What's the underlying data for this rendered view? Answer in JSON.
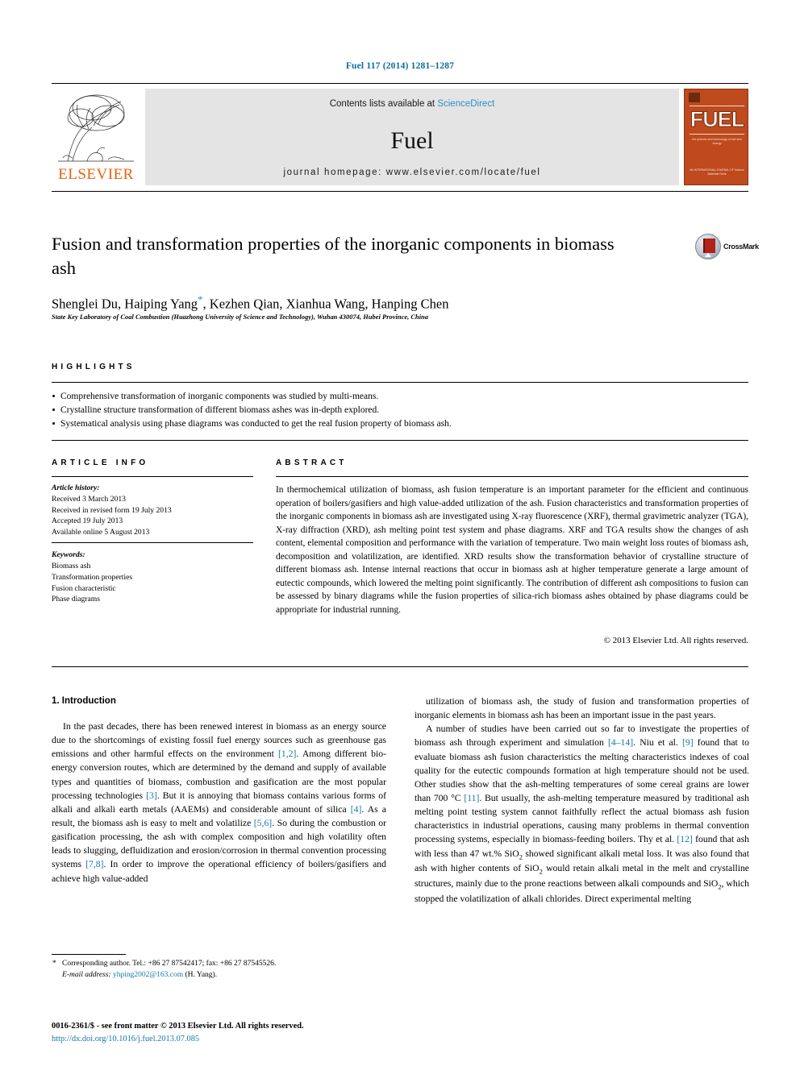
{
  "journal_ref": "Fuel 117 (2014) 1281–1287",
  "header": {
    "publisher": "ELSEVIER",
    "contents_prefix": "Contents lists available at ",
    "contents_link": "ScienceDirect",
    "journal_title": "Fuel",
    "homepage": "journal homepage: www.elsevier.com/locate/fuel",
    "cover": {
      "word": "FUEL",
      "subtitle": "the science and technology of fuel and energy",
      "footer": "AN INTERNATIONAL JOURNAL OF\nScience Materials Fuels"
    }
  },
  "article": {
    "title": "Fusion and transformation properties of the inorganic components in biomass ash",
    "authors": "Shenglei Du, Haiping Yang",
    "authors_tail": ", Kezhen Qian, Xianhua Wang, Hanping Chen",
    "corresponding_marker": "*",
    "affiliation": "State Key Laboratory of Coal Combustion (Huazhong University of Science and Technology), Wuhan 430074, Hubei Province, China",
    "crossmark_label": "CrossMark"
  },
  "highlights": {
    "heading": "HIGHLIGHTS",
    "items": [
      "Comprehensive transformation of inorganic components was studied by multi-means.",
      "Crystalline structure transformation of different biomass ashes was in-depth explored.",
      "Systematical analysis using phase diagrams was conducted to get the real fusion property of biomass ash."
    ]
  },
  "article_info": {
    "heading": "ARTICLE INFO",
    "history_label": "Article history:",
    "history": [
      "Received 3 March 2013",
      "Received in revised form 19 July 2013",
      "Accepted 19 July 2013",
      "Available online 5 August 2013"
    ],
    "keywords_label": "Keywords:",
    "keywords": [
      "Biomass ash",
      "Transformation properties",
      "Fusion characteristic",
      "Phase diagrams"
    ]
  },
  "abstract": {
    "heading": "ABSTRACT",
    "text": "In thermochemical utilization of biomass, ash fusion temperature is an important parameter for the efficient and continuous operation of boilers/gasifiers and high value-added utilization of the ash. Fusion characteristics and transformation properties of the inorganic components in biomass ash are investigated using X-ray fluorescence (XRF), thermal gravimetric analyzer (TGA), X-ray diffraction (XRD), ash melting point test system and phase diagrams. XRF and TGA results show the changes of ash content, elemental composition and performance with the variation of temperature. Two main weight loss routes of biomass ash, decomposition and volatilization, are identified. XRD results show the transformation behavior of crystalline structure of different biomass ash. Intense internal reactions that occur in biomass ash at higher temperature generate a large amount of eutectic compounds, which lowered the melting point significantly. The contribution of different ash compositions to fusion can be assessed by binary diagrams while the fusion properties of silica-rich biomass ashes obtained by phase diagrams could be appropriate for industrial running.",
    "copyright": "© 2013 Elsevier Ltd. All rights reserved."
  },
  "body": {
    "section_heading": "1. Introduction",
    "left_paragraph": "In the past decades, there has been renewed interest in biomass as an energy source due to the shortcomings of existing fossil fuel energy sources such as greenhouse gas emissions and other harmful effects on the environment [1,2]. Among different bio-energy conversion routes, which are determined by the demand and supply of available types and quantities of biomass, combustion and gasification are the most popular processing technologies [3]. But it is annoying that biomass contains various forms of alkali and alkali earth metals (AAEMs) and considerable amount of silica [4]. As a result, the biomass ash is easy to melt and volatilize [5,6]. So during the combustion or gasification processing, the ash with complex composition and high volatility often leads to slugging, defluidization and erosion/corrosion in thermal convention processing systems [7,8]. In order to improve the operational efficiency of boilers/gasifiers and achieve high value-added",
    "right_paragraph_1": "utilization of biomass ash, the study of fusion and transformation properties of inorganic elements in biomass ash has been an important issue in the past years.",
    "right_paragraph_2": "A number of studies have been carried out so far to investigate the properties of biomass ash through experiment and simulation [4–14]. Niu et al. [9] found that to evaluate biomass ash fusion characteristics the melting characteristics indexes of coal quality for the eutectic compounds formation at high temperature should not be used. Other studies show that the ash-melting temperatures of some cereal grains are lower than 700 °C [11]. But usually, the ash-melting temperature measured by traditional ash melting point testing system cannot faithfully reflect the actual biomass ash fusion characteristics in industrial operations, causing many problems in thermal convention processing systems, especially in biomass-feeding boilers. Thy et al. [12] found that ash with less than 47 wt.% SiO2 showed significant alkali metal loss. It was also found that ash with higher contents of SiO2 would retain alkali metal in the melt and crystalline structures, mainly due to the prone reactions between alkali compounds and SiO2, which stopped the volatilization of alkali chlorides. Direct experimental melting"
  },
  "footnote": {
    "marker": "*",
    "corresponding": "Corresponding author. Tel.: +86 27 87542417; fax: +86 27 87545526.",
    "email_label": "E-mail address:",
    "email": "yhping2002@163.com",
    "email_tail": " (H. Yang)."
  },
  "footer": {
    "issn_line": "0016-2361/$ - see front matter © 2013 Elsevier Ltd. All rights reserved.",
    "doi": "http://dx.doi.org/10.1016/j.fuel.2013.07.085"
  },
  "colors": {
    "link": "#1777a8",
    "journal_ref": "#0b6c9a",
    "elsevier_orange": "#E8620C",
    "cover_red": "#BE4A1E"
  }
}
